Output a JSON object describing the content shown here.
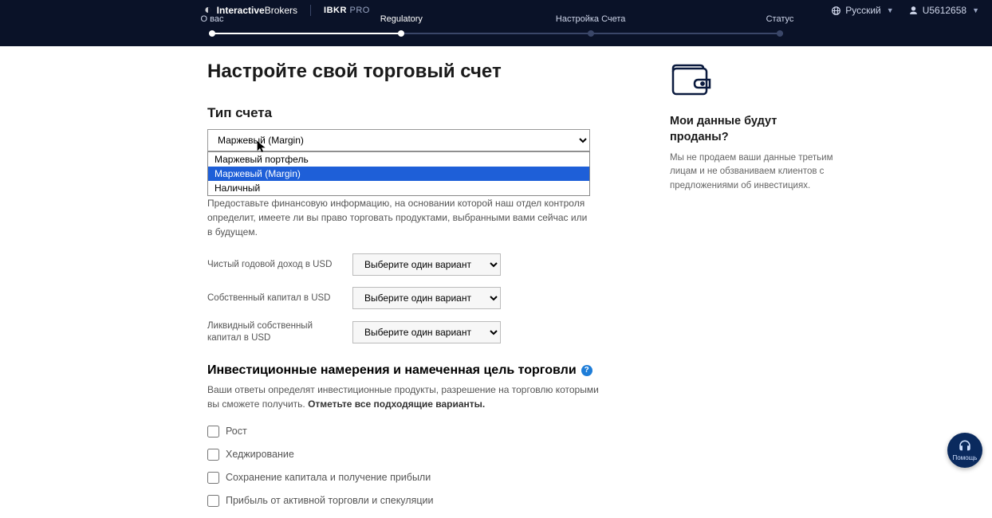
{
  "header": {
    "brand_bold": "Interactive",
    "brand_light": "Brokers",
    "pro_label_b": "IBKR",
    "pro_label": " PRO",
    "language": "Русский",
    "account": "U5612658"
  },
  "progress": {
    "steps": [
      "О вас",
      "Regulatory",
      "Настройка Счета",
      "Статус"
    ],
    "active_index": 1
  },
  "main": {
    "title": "Настройте свой торговый счет",
    "account_type_label": "Тип счета",
    "account_type_selected": "Маржевый (Margin)",
    "account_type_options": [
      "Маржевый портфель",
      "Маржевый (Margin)",
      "Наличный"
    ],
    "financial_desc": "Предоставьте финансовую информацию, на основании которой наш отдел контроля определит, имеете ли вы право торговать продуктами, выбранными вами сейчас или в будущем.",
    "fields": [
      {
        "label": "Чистый годовой доход в USD",
        "placeholder": "Выберите один вариант"
      },
      {
        "label": "Собственный капитал в USD",
        "placeholder": "Выберите один вариант"
      },
      {
        "label": "Ликвидный собственный капитал в USD",
        "placeholder": "Выберите один вариант"
      }
    ],
    "invest_heading": "Инвестиционные намерения и намеченная цель торговли",
    "invest_desc_1": "Ваши ответы определят инвестиционные продукты, разрешение на торговлю которыми вы сможете получить. ",
    "invest_desc_bold": "Отметьте все подходящие варианты.",
    "checkboxes": [
      "Рост",
      "Хеджирование",
      "Сохранение капитала и получение прибыли",
      "Прибыль от активной торговли и спекуляции"
    ]
  },
  "side": {
    "heading": "Мои данные будут проданы?",
    "body": "Мы не продаем ваши данные третьим лицам и не обзваниваем клиентов с предложениями об инвестициях."
  },
  "help_label": "Помощь"
}
